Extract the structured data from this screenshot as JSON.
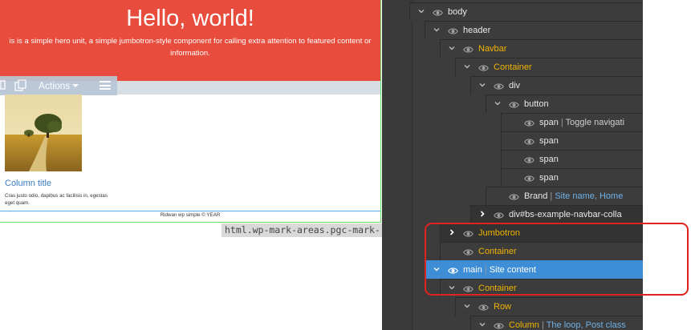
{
  "preview": {
    "hero": {
      "title": "Hello, world!",
      "text_line1": "is is a simple hero unit, a simple jumbotron-style component for calling extra attention to featured content or",
      "text_line2": "information."
    },
    "toolbar": {
      "actions_label": "Actions",
      "icons": [
        "grid-icon",
        "copy-icon",
        "chevron-down-icon",
        "menu-icon"
      ]
    },
    "column": {
      "title": "Column title",
      "text": "Cras justo odio, dapibus ac facilisis in, egestas eget quam."
    },
    "footer_text": "Ridwan wp simple © YEAR",
    "selected_element_tooltip": "html.wp-mark-areas.pgc-mark-..."
  },
  "layers": [
    {
      "name": "body",
      "description": "",
      "depth": 0,
      "toggle": "open",
      "style": "normal"
    },
    {
      "name": "header",
      "description": "",
      "depth": 1,
      "toggle": "open",
      "style": "normal"
    },
    {
      "name": "Navbar",
      "description": "",
      "depth": 2,
      "toggle": "open",
      "style": "component"
    },
    {
      "name": "Container",
      "description": "",
      "depth": 3,
      "toggle": "open",
      "style": "component"
    },
    {
      "name": "div",
      "description": "",
      "depth": 4,
      "toggle": "open",
      "style": "normal"
    },
    {
      "name": "button",
      "description": "",
      "depth": 5,
      "toggle": "open",
      "style": "normal"
    },
    {
      "name": "span",
      "description": "Toggle navigati",
      "depth": 6,
      "toggle": "none",
      "style": "normal"
    },
    {
      "name": "span",
      "description": "",
      "depth": 6,
      "toggle": "none",
      "style": "normal"
    },
    {
      "name": "span",
      "description": "",
      "depth": 6,
      "toggle": "none",
      "style": "normal"
    },
    {
      "name": "span",
      "description": "",
      "depth": 6,
      "toggle": "none",
      "style": "normal"
    },
    {
      "name": "Brand",
      "description": "Site name, Home",
      "depth": 5,
      "toggle": "none",
      "style": "normal"
    },
    {
      "name": "div#bs-example-navbar-colla",
      "description": "",
      "depth": 4,
      "toggle": "closed",
      "style": "normal"
    },
    {
      "name": "Jumbotron",
      "description": "",
      "depth": 2,
      "toggle": "closed",
      "style": "component"
    },
    {
      "name": "Container",
      "description": "",
      "depth": 2,
      "toggle": "none",
      "style": "component"
    },
    {
      "name": "main",
      "description": "Site content",
      "depth": 1,
      "toggle": "open",
      "style": "selected"
    },
    {
      "name": "Container",
      "description": "",
      "depth": 2,
      "toggle": "open",
      "style": "component"
    },
    {
      "name": "Row",
      "description": "",
      "depth": 3,
      "toggle": "open",
      "style": "component"
    },
    {
      "name": "Column",
      "description": "The loop, Post class",
      "depth": 4,
      "toggle": "open",
      "style": "component"
    }
  ],
  "colors": {
    "hero_background": "#e74c3c",
    "panel_background": "#3c3c3c",
    "selected_row": "#3d8ed6",
    "component_label": "#f0b400",
    "description_label": "#6fb1e7",
    "annotation_outline": "#e0231f"
  }
}
